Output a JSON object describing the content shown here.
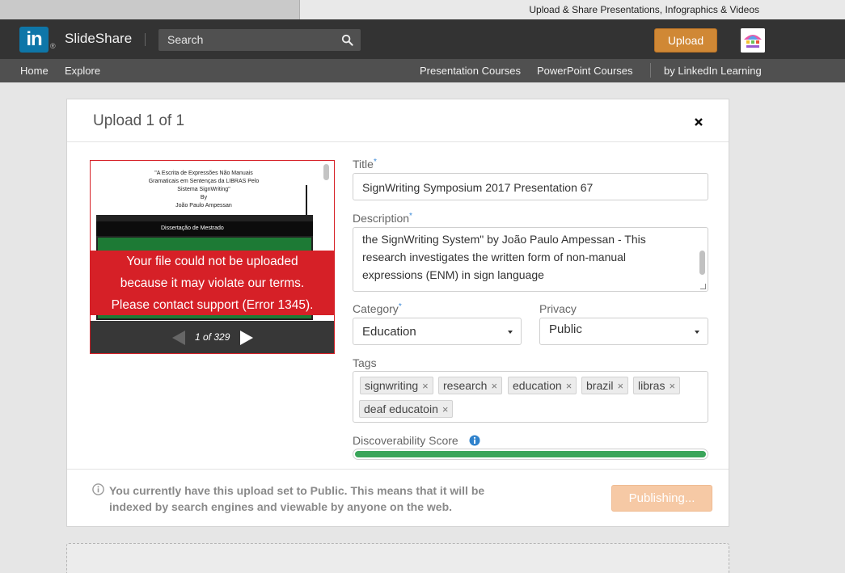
{
  "browser": {
    "tab_title": "Upload & Share Presentations, Infographics & Videos"
  },
  "header": {
    "logo_text": "in",
    "brand": "SlideShare",
    "search_placeholder": "Search",
    "upload_label": "Upload",
    "icons": [
      "search-icon",
      "avatar"
    ],
    "accent_color": "#d08835"
  },
  "subnav": {
    "left": [
      "Home",
      "Explore"
    ],
    "right": [
      "Presentation Courses",
      "PowerPoint Courses",
      "by LinkedIn Learning"
    ]
  },
  "modal": {
    "title": "Upload 1 of 1",
    "preview": {
      "doc_lines": [
        "\"A Escrita de Expressões Não Manuais",
        "Gramaticais em Sentenças da LIBRAS Pelo",
        "Sistema SignWriting\"",
        "By",
        "João Paulo Ampessan"
      ],
      "slide_band": "Dissertação de Mestrado",
      "error_lines": [
        "Your file could not be uploaded",
        "because it may violate our terms.",
        "Please contact support (Error 1345)."
      ],
      "pager": "1 of 329",
      "error_color": "#d62027"
    },
    "form": {
      "title_label": "Title",
      "title_value": "SignWriting Symposium 2017 Presentation 67",
      "description_label": "Description",
      "description_lines": [
        "the SignWriting System\" by João Paulo Ampessan - This",
        "research investigates the written form of non-manual",
        "expressions (ENM) in sign language"
      ],
      "category_label": "Category",
      "category_value": "Education",
      "privacy_label": "Privacy",
      "privacy_value": "Public",
      "tags_label": "Tags",
      "tags": [
        "signwriting",
        "research",
        "education",
        "brazil",
        "libras",
        "deaf educatoin"
      ],
      "tag_remove": "×",
      "score_label": "Discoverability Score",
      "score_fraction": 1.0,
      "score_color": "#3aa55a",
      "required_mark": "*"
    },
    "footer": {
      "notice_line1": "You currently have this upload set to Public. This means that it will be",
      "notice_line2": "indexed by search engines and viewable by anyone on the web.",
      "publish_label": "Publishing..."
    }
  }
}
